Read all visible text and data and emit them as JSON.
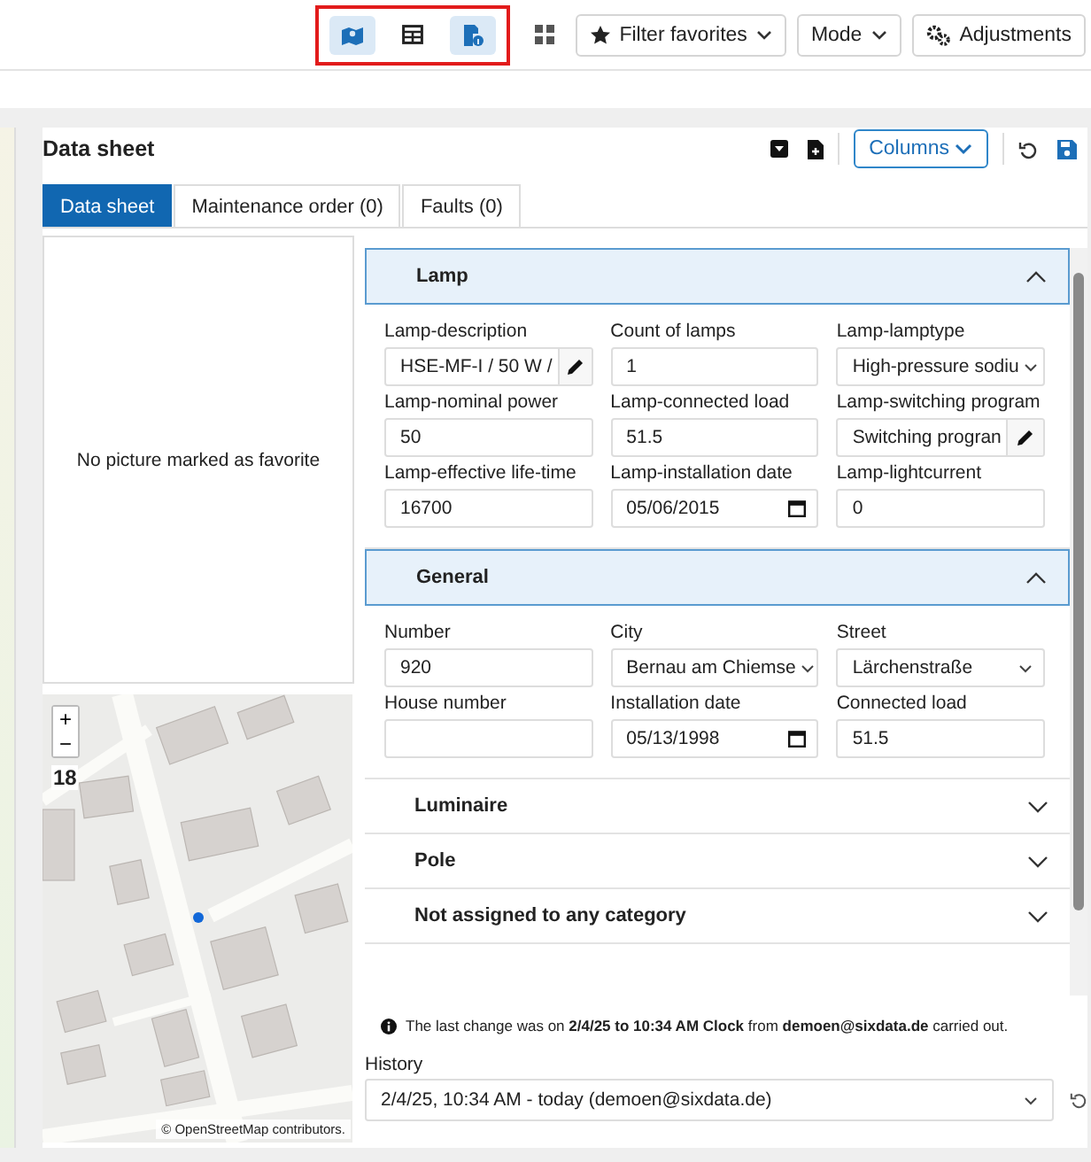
{
  "toolbar": {
    "views": [
      {
        "kind": "map",
        "selected": true
      },
      {
        "kind": "table",
        "selected": false
      },
      {
        "kind": "detail",
        "selected": true
      }
    ],
    "buttons": [
      {
        "kind": "filter",
        "label": "Filter favorites"
      },
      {
        "kind": "mode",
        "label": "Mode"
      },
      {
        "kind": "settings",
        "label": "Adjustments"
      }
    ]
  },
  "panel": {
    "title": "Data sheet",
    "columns_button": "Columns",
    "tabs": [
      {
        "label": "Data sheet",
        "selected": true
      },
      {
        "label": "Maintenance order (0)",
        "selected": false
      },
      {
        "label": "Faults (0)",
        "selected": false
      }
    ],
    "picture_message": "No picture marked as favorite",
    "map": {
      "zoom_level": "18",
      "zoom_in": "+",
      "zoom_out": "−",
      "attribution": "© OpenStreetMap contributors."
    },
    "sections": [
      {
        "title": "Lamp",
        "expanded": true,
        "fields": [
          {
            "label": "Lamp-description",
            "value": "HSE-MF-I / 50 W /",
            "kind": "edit"
          },
          {
            "label": "Count of lamps",
            "value": "1",
            "kind": "text"
          },
          {
            "label": "Lamp-lamptype",
            "value": "High-pressure sodiu",
            "kind": "select"
          },
          {
            "label": "Lamp-nominal power",
            "value": "50",
            "kind": "text"
          },
          {
            "label": "Lamp-connected load",
            "value": "51.5",
            "kind": "text"
          },
          {
            "label": "Lamp-switching program",
            "value": "Switching progran",
            "kind": "edit"
          },
          {
            "label": "Lamp-effective life-time",
            "value": "16700",
            "kind": "text"
          },
          {
            "label": "Lamp-installation date",
            "value": "05/06/2015",
            "kind": "date"
          },
          {
            "label": "Lamp-lightcurrent",
            "value": "0",
            "kind": "text"
          }
        ]
      },
      {
        "title": "General",
        "expanded": true,
        "fields": [
          {
            "label": "Number",
            "value": "920",
            "kind": "text"
          },
          {
            "label": "City",
            "value": "Bernau am Chiemse",
            "kind": "select"
          },
          {
            "label": "Street",
            "value": "Lärchenstraße",
            "kind": "select"
          },
          {
            "label": "House number",
            "kind": "text"
          },
          {
            "label": "Installation date",
            "value": "05/13/1998",
            "kind": "date"
          },
          {
            "label": "Connected load",
            "value": "51.5",
            "kind": "text"
          }
        ]
      },
      {
        "title": "Luminaire",
        "expanded": false
      },
      {
        "title": "Pole",
        "expanded": false
      },
      {
        "title": "Not assigned to any category",
        "expanded": false
      }
    ],
    "info": "The last change was on **2/4/25 to 10:34 AM Clock** from **demoen@sixdata.de** carried out.",
    "history": {
      "label": "History",
      "value": "2/4/25, 10:34 AM - today (demoen@sixdata.de)"
    }
  }
}
